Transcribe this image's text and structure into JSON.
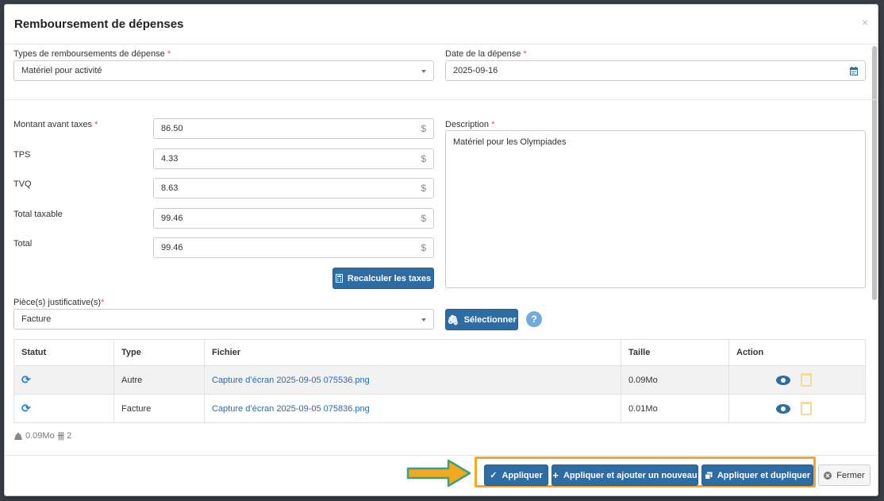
{
  "modal": {
    "title": "Remboursement de dépenses",
    "close_symbol": "×"
  },
  "form": {
    "type_label": "Types de remboursements de dépense",
    "type_value": "Matériel pour activité",
    "date_label": "Date de la dépense",
    "date_value": "2025-09-16",
    "amount_label": "Montant avant taxes",
    "amount_value": "86.50",
    "tps_label": "TPS",
    "tps_value": "4.33",
    "tvq_label": "TVQ",
    "tvq_value": "8.63",
    "total_taxable_label": "Total taxable",
    "total_taxable_value": "99.46",
    "total_label": "Total",
    "total_value": "99.46",
    "currency_symbol": "$",
    "recalc_button": "Recalculer les taxes",
    "description_label": "Description",
    "description_value": "Matériel pour les Olympiades",
    "attachment_label": "Pièce(s) justificative(s)",
    "attachment_value": "Facture",
    "select_button": "Sélectionner",
    "help_symbol": "?",
    "required_mark": "*"
  },
  "table": {
    "headers": [
      "Statut",
      "Type",
      "Fichier",
      "Taille",
      "Action"
    ],
    "rows": [
      {
        "type": "Autre",
        "file": "Capture d’écran 2025-09-05 075536.png",
        "size": "0.09Mo"
      },
      {
        "type": "Facture",
        "file": "Capture d’écran 2025-09-05 075836.png",
        "size": "0.01Mo"
      }
    ]
  },
  "summary": {
    "size": "0.09Mo",
    "count": "2"
  },
  "footer": {
    "apply": "Appliquer",
    "apply_new": "Appliquer et ajouter un nouveau",
    "apply_duplicate": "Appliquer et dupliquer",
    "close": "Fermer"
  },
  "colors": {
    "primary": "#2e6da4",
    "highlight": "#f5a623",
    "arrow_fill": "#f5a623",
    "arrow_stroke": "#3aa37a",
    "required": "#d9534f"
  }
}
